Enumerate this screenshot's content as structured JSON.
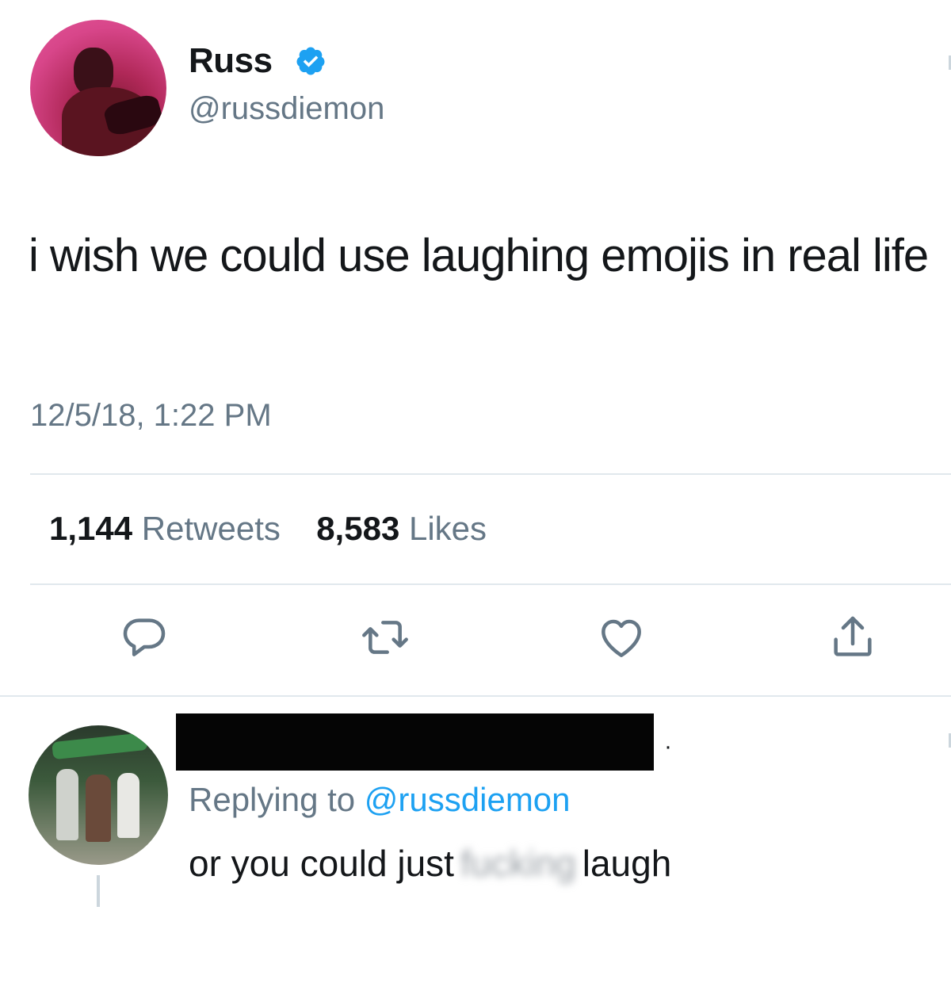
{
  "tweet": {
    "author_name": "Russ",
    "author_handle": "@russdiemon",
    "verified": true,
    "text": "i wish we could use laughing emojis in real life",
    "timestamp": "12/5/18, 1:22 PM",
    "retweet_count": "1,144",
    "retweet_label": "Retweets",
    "like_count": "8,583",
    "like_label": "Likes",
    "actions": [
      "reply-icon",
      "retweet-icon",
      "like-icon",
      "share-icon"
    ]
  },
  "reply": {
    "replying_prefix": "Replying to",
    "replying_to": "@russdiemon",
    "text_before": "or you could just",
    "text_blurred": "fucking",
    "text_after": "laugh"
  },
  "colors": {
    "verified_blue": "#1da1f2",
    "mention_blue": "#1da1f2",
    "secondary_text": "#657786",
    "icon_gray": "#657786"
  }
}
